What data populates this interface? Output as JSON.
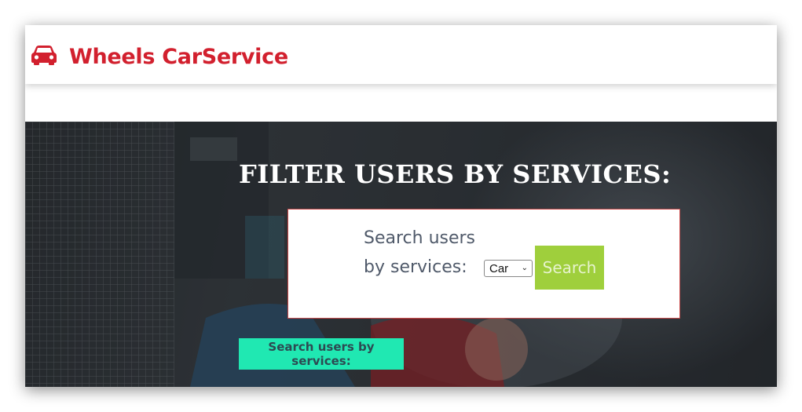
{
  "header": {
    "brand_name": "Wheels CarService",
    "brand_icon": "car-icon",
    "brand_color": "#d2202e"
  },
  "hero": {
    "title": "FILTER USERS BY SERVICES:",
    "filter": {
      "label": "Search users by services:",
      "select_value": "Car",
      "search_label": "Search"
    },
    "secondary_button_label": "Search users by services:"
  },
  "colors": {
    "search_button": "#9acd32",
    "secondary_button": "#20e8b2",
    "card_border": "#c94a4a"
  }
}
